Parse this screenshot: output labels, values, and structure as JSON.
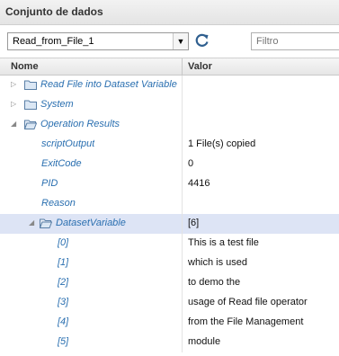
{
  "panel": {
    "title": "Conjunto de dados"
  },
  "toolbar": {
    "dataset_selected": "Read_from_File_1",
    "filter_placeholder": "Filtro"
  },
  "table": {
    "col_name": "Nome",
    "col_value": "Valor"
  },
  "rows": [
    {
      "name": "Read File into Dataset Variable",
      "value": ""
    },
    {
      "name": "System",
      "value": ""
    },
    {
      "name": "Operation Results",
      "value": ""
    },
    {
      "name": "scriptOutput",
      "value": "1 File(s) copied"
    },
    {
      "name": "ExitCode",
      "value": "0"
    },
    {
      "name": "PID",
      "value": "4416"
    },
    {
      "name": "Reason",
      "value": ""
    },
    {
      "name": "DatasetVariable",
      "value": "[6]"
    },
    {
      "name": "[0]",
      "value": "This is a test file"
    },
    {
      "name": "[1]",
      "value": "which is used"
    },
    {
      "name": "[2]",
      "value": "to demo the"
    },
    {
      "name": "[3]",
      "value": "usage of Read file operator"
    },
    {
      "name": "[4]",
      "value": "from the File Management"
    },
    {
      "name": "[5]",
      "value": "module"
    }
  ],
  "icons": {
    "folder": "folder-icon",
    "open_folder": "folder-open-icon",
    "refresh": "refresh-icon",
    "dropdown": "chevron-down-icon"
  }
}
